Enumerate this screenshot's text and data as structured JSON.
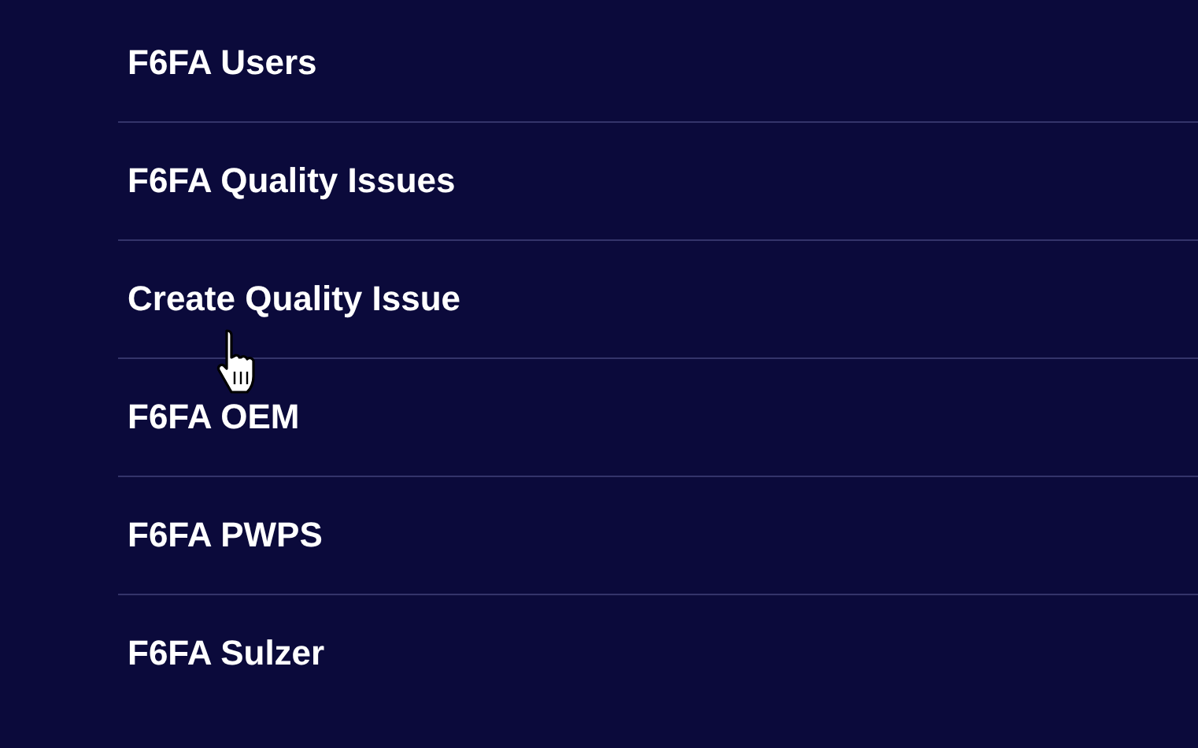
{
  "menu": {
    "items": [
      {
        "label": "F6FA Users"
      },
      {
        "label": "F6FA Quality Issues"
      },
      {
        "label": "Create Quality Issue"
      },
      {
        "label": "F6FA OEM"
      },
      {
        "label": "F6FA PWPS"
      },
      {
        "label": "F6FA Sulzer"
      }
    ]
  }
}
